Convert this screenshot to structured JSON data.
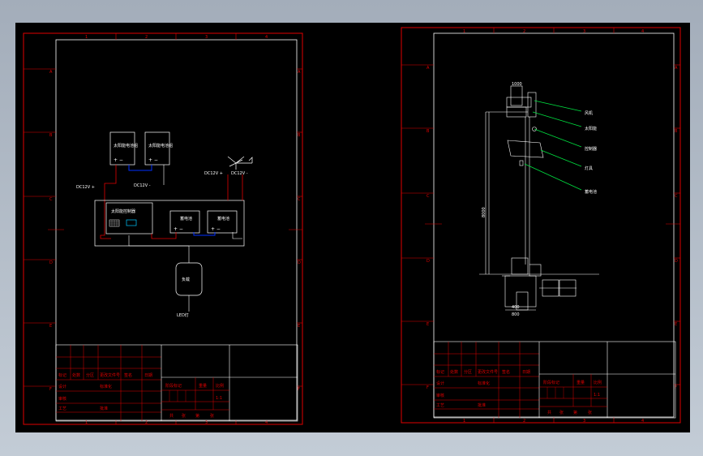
{
  "zone_columns": [
    "1",
    "2",
    "3",
    "4"
  ],
  "zone_rows": [
    "A",
    "B",
    "C",
    "D",
    "E",
    "F"
  ],
  "sheet1": {
    "panel_left": "太阳能电池组",
    "panel_right": "太阳能电池组",
    "controller_label": "太阳能控制器",
    "battery1": "蓄电池",
    "battery2": "蓄电池",
    "load_label": "负载",
    "wind_label": "风机",
    "labels": [
      "DC12V +",
      "DC12V -",
      "DC12V +",
      "DC12V -"
    ],
    "bottom_code": "LED灯"
  },
  "sheet2": {
    "callouts": [
      "风机",
      "太阳能",
      "控制器",
      "灯具",
      "蓄电池"
    ],
    "top_dim": "1000",
    "side_dim": "8000",
    "base_dims": [
      "400",
      "800"
    ]
  },
  "title_block": {
    "row1": [
      "标记",
      "处数",
      "分区",
      "更改文件号",
      "签名",
      "日期"
    ],
    "row2": [
      "设计",
      "标准化"
    ],
    "row3": [
      "审核"
    ],
    "row4": [
      "工艺",
      "批准"
    ],
    "stage_header": [
      "阶段标记",
      "重量",
      "比例"
    ],
    "scale": "1:1",
    "sheet_info": [
      "共",
      "张",
      "第",
      "张"
    ]
  }
}
